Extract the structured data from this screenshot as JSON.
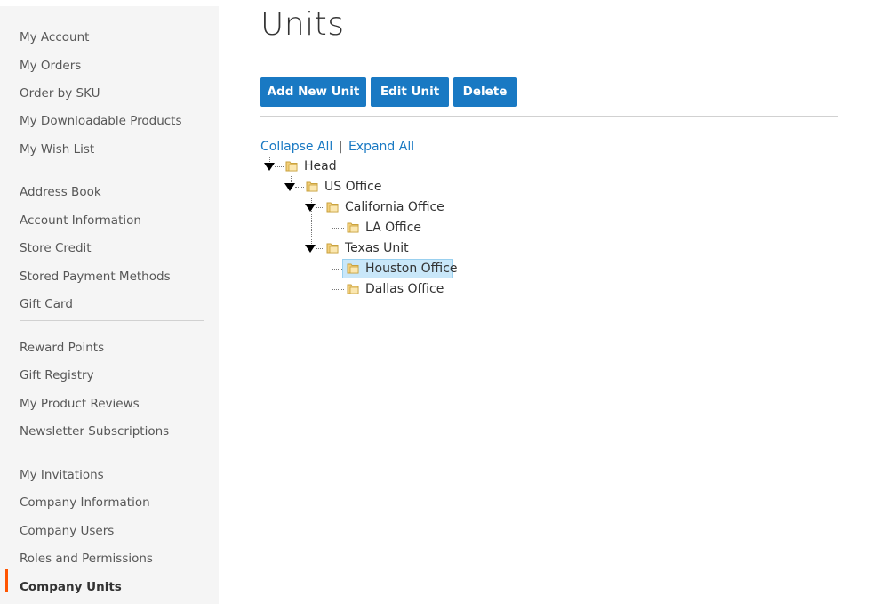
{
  "sidebar": {
    "groups": [
      [
        "My Account",
        "My Orders",
        "Order by SKU",
        "My Downloadable Products",
        "My Wish List"
      ],
      [
        "Address Book",
        "Account Information",
        "Store Credit",
        "Stored Payment Methods",
        "Gift Card"
      ],
      [
        "Reward Points",
        "Gift Registry",
        "My Product Reviews",
        "Newsletter Subscriptions"
      ],
      [
        "My Invitations",
        "Company Information",
        "Company Users",
        "Roles and Permissions",
        "Company Units"
      ]
    ],
    "current_item": "Company Units",
    "accent_color": "#ff5501"
  },
  "page": {
    "title": "Units"
  },
  "toolbar": {
    "add_label": "Add New Unit",
    "edit_label": "Edit Unit",
    "delete_label": "Delete",
    "button_color": "#1979c3"
  },
  "tree": {
    "collapse_all": "Collapse All",
    "separator": "|",
    "expand_all": "Expand All",
    "nodes": {
      "head": "Head",
      "us_office": "US Office",
      "california_office": "California Office",
      "la_office": "LA Office",
      "texas_unit": "Texas Unit",
      "houston_office": "Houston Office",
      "dallas_office": "Dallas Office"
    },
    "selected": "Houston Office",
    "folder_icon": "folder-icon",
    "expanded_icon": "arrow-down-icon"
  }
}
